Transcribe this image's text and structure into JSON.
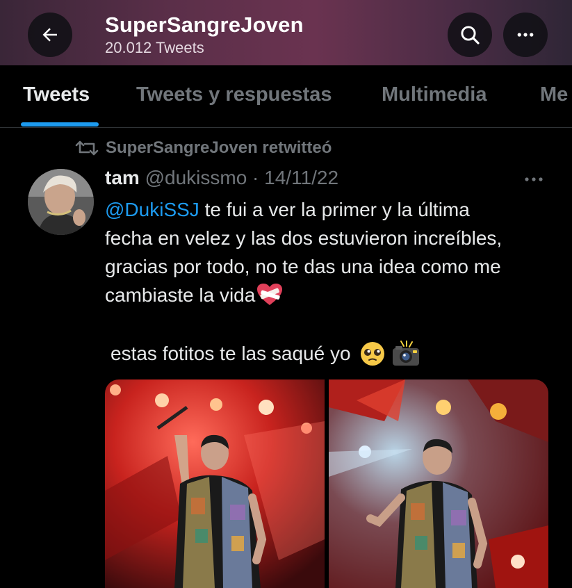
{
  "header": {
    "title": "SuperSangreJoven",
    "subtitle": "20.012 Tweets",
    "back_icon": "arrow-left-icon",
    "search_icon": "search-icon",
    "more_icon": "more-horizontal-icon"
  },
  "tabs": [
    {
      "label": "Tweets",
      "active": true
    },
    {
      "label": "Tweets y respuestas",
      "active": false
    },
    {
      "label": "Multimedia",
      "active": false
    },
    {
      "label": "Me",
      "active": false
    }
  ],
  "tweet": {
    "retweet_label": "SuperSangreJoven retwitteó",
    "author_name": "tam",
    "author_handle": "@dukissmo",
    "separator": "·",
    "date": "14/11/22",
    "mention": "@DukiSSJ",
    "text_line1": " te fui a ver la primer y la última",
    "text_rest": "fecha en velez y las dos estuvieron increíbles, gracias por todo, no te das una idea como me cambiaste la vida",
    "text_second": "estas fotitos te las saqué yo",
    "colors": {
      "accent": "#1d9bf0",
      "muted": "#71767b",
      "text": "#e7e9ea",
      "background": "#000000"
    }
  }
}
